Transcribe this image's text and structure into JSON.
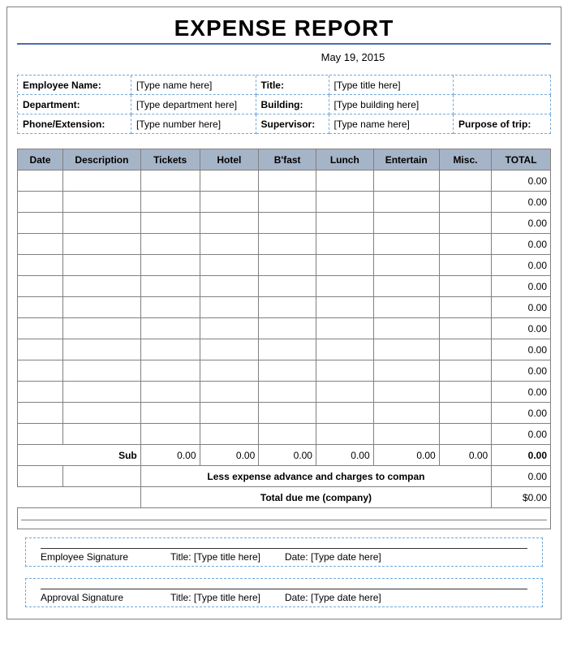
{
  "title": "EXPENSE REPORT",
  "date": "May 19, 2015",
  "info": {
    "employee_name_label": "Employee Name:",
    "employee_name_ph": "[Type name here]",
    "title_label": "Title:",
    "title_ph": "[Type title here]",
    "department_label": "Department:",
    "department_ph": "[Type department here]",
    "building_label": "Building:",
    "building_ph": "[Type building here]",
    "phone_label": "Phone/Extension:",
    "phone_ph": "[Type number here]",
    "supervisor_label": "Supervisor:",
    "supervisor_ph": "[Type name here]",
    "purpose_label": "Purpose of trip:"
  },
  "columns": {
    "date": "Date",
    "description": "Description",
    "tickets": "Tickets",
    "hotel": "Hotel",
    "bfast": "B'fast",
    "lunch": "Lunch",
    "entertain": "Entertain",
    "misc": "Misc.",
    "total": "TOTAL"
  },
  "rows": [
    {
      "total": "0.00"
    },
    {
      "total": "0.00"
    },
    {
      "total": "0.00"
    },
    {
      "total": "0.00"
    },
    {
      "total": "0.00"
    },
    {
      "total": "0.00"
    },
    {
      "total": "0.00"
    },
    {
      "total": "0.00"
    },
    {
      "total": "0.00"
    },
    {
      "total": "0.00"
    },
    {
      "total": "0.00"
    },
    {
      "total": "0.00"
    },
    {
      "total": "0.00"
    }
  ],
  "subtotal": {
    "label": "Sub",
    "tickets": "0.00",
    "hotel": "0.00",
    "bfast": "0.00",
    "lunch": "0.00",
    "entertain": "0.00",
    "misc": "0.00",
    "total": "0.00"
  },
  "less_advance": {
    "label": "Less expense advance and charges to compan",
    "value": "0.00"
  },
  "total_due": {
    "label": "Total due me (company)",
    "value": "$0.00"
  },
  "sig": {
    "employee_label": "Employee Signature",
    "approval_label": "Approval Signature",
    "title_label": "Title:",
    "title_ph": "[Type title here]",
    "date_label": "Date:",
    "date_ph": "[Type date here]"
  }
}
